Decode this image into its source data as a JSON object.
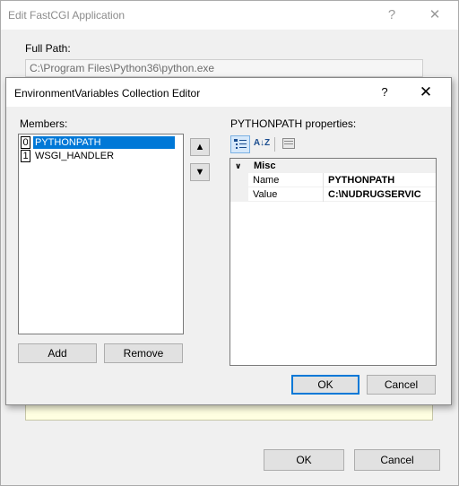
{
  "outer": {
    "title": "Edit FastCGI Application",
    "help_glyph": "?",
    "close_glyph": "✕",
    "full_path_label": "Full Path:",
    "full_path_value": "C:\\Program Files\\Python36\\python.exe",
    "ok_label": "OK",
    "cancel_label": "Cancel"
  },
  "inner": {
    "title": "EnvironmentVariables Collection Editor",
    "help_glyph": "?",
    "close_glyph": "✕",
    "members_label": "Members:",
    "members": [
      {
        "index": "0",
        "name": "PYTHONPATH",
        "selected": true
      },
      {
        "index": "1",
        "name": "WSGI_HANDLER",
        "selected": false
      }
    ],
    "move_up_glyph": "▲",
    "move_down_glyph": "▼",
    "add_label": "Add",
    "remove_label": "Remove",
    "properties_label": "PYTHONPATH properties:",
    "toolbar": {
      "categorized_icon": "categorized-icon",
      "alphabetical_icon": "alphabetical-sort-icon",
      "property_pages_icon": "property-pages-icon",
      "alphabetical_text": "A↓Z"
    },
    "grid": {
      "category": "Misc",
      "collapse_glyph": "∨",
      "properties": [
        {
          "name": "Name",
          "value": "PYTHONPATH"
        },
        {
          "name": "Value",
          "value": "C:\\NUDRUGSERVIC"
        }
      ]
    },
    "ok_label": "OK",
    "cancel_label": "Cancel"
  },
  "colors": {
    "selection": "#0078d7",
    "hint_background": "#ffffe1",
    "window_background": "#f0f0f0"
  }
}
